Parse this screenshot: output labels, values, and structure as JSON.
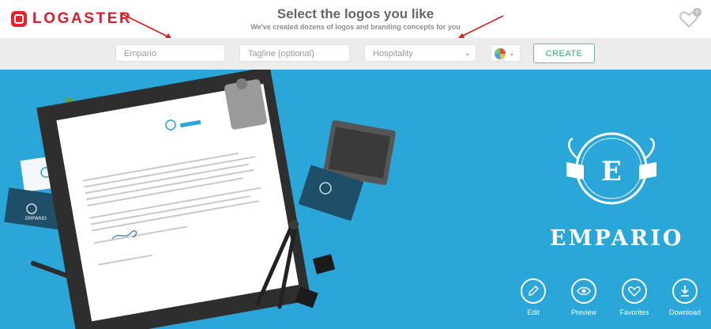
{
  "header": {
    "brand": "LOGASTER",
    "title": "Select the logos you like",
    "subtitle": "We've created dozens of logos and branding concepts for you",
    "favorites_count": "0"
  },
  "toolbar": {
    "name_value": "Empario",
    "tagline_placeholder": "Tagline (optional)",
    "industry_value": "Hospitality",
    "create_label": "CREATE"
  },
  "preview": {
    "brand_name": "EMPARIO",
    "emblem_letter": "E",
    "mockup_brand": "EMPARIO",
    "actions": [
      "Edit",
      "Preview",
      "Favorites",
      "Download"
    ]
  },
  "colors": {
    "accent": "#d71f2b",
    "background": "#2aa6d8",
    "create": "#3da86c"
  }
}
